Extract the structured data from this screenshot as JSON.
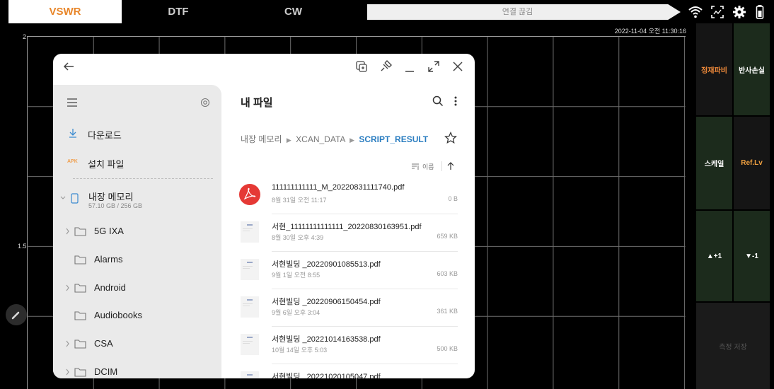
{
  "tabs": [
    {
      "label": "VSWR",
      "active": true
    },
    {
      "label": "DTF",
      "active": false
    },
    {
      "label": "CW",
      "active": false
    }
  ],
  "connection_status": "연결 끊김",
  "status_icons": [
    "wifi-icon",
    "screenshot-icon",
    "gear-icon",
    "battery-icon"
  ],
  "chart": {
    "timestamp": "2022-11-04 오전 11:30:16",
    "y_labels": [
      "2",
      "1.5"
    ]
  },
  "right_panel": {
    "vswr_label": "정재파비",
    "return_loss_label": "반사손실",
    "scale_label": "스케일",
    "ref_level_label": "Ref.Lv",
    "up_label": "▲+1",
    "down_label": "▼-1",
    "save_label": "측정 저장"
  },
  "file_manager": {
    "title": "내 파일",
    "sidebar": {
      "downloads": "다운로드",
      "apk_badge": "APK",
      "install_files": "설치 파일",
      "internal_storage": "내장 메모리",
      "storage_usage": "57.10 GB / 256 GB",
      "folders": [
        "5G IXA",
        "Alarms",
        "Android",
        "Audiobooks",
        "CSA",
        "DCIM"
      ]
    },
    "breadcrumb": [
      "내장 메모리",
      "XCAN_DATA",
      "SCRIPT_RESULT"
    ],
    "sort_label": "이름",
    "files": [
      {
        "name": "111111111111_M_20220831111740.pdf",
        "date": "8월 31일 오전 11:17",
        "size": "0 B"
      },
      {
        "name": "서현_11111111111111_20220830163951.pdf",
        "date": "8월 30일 오후 4:39",
        "size": "659 KB"
      },
      {
        "name": "서현빌딩 _20220901085513.pdf",
        "date": "9월 1일 오전 8:55",
        "size": "603 KB"
      },
      {
        "name": "서현빌딩 _20220906150454.pdf",
        "date": "9월 6일 오후 3:04",
        "size": "361 KB"
      },
      {
        "name": "서현빌딩 _20221014163538.pdf",
        "date": "10월 14일 오후 5:03",
        "size": "500 KB"
      },
      {
        "name": "서현빌딩 _20221020105047.pdf",
        "date": "",
        "size": ""
      }
    ]
  },
  "colors": {
    "accent_orange": "#e8862a",
    "ref_lv_orange": "#f0a040",
    "link_blue": "#2a7dc0",
    "panel_green": "#1a2a1a"
  }
}
